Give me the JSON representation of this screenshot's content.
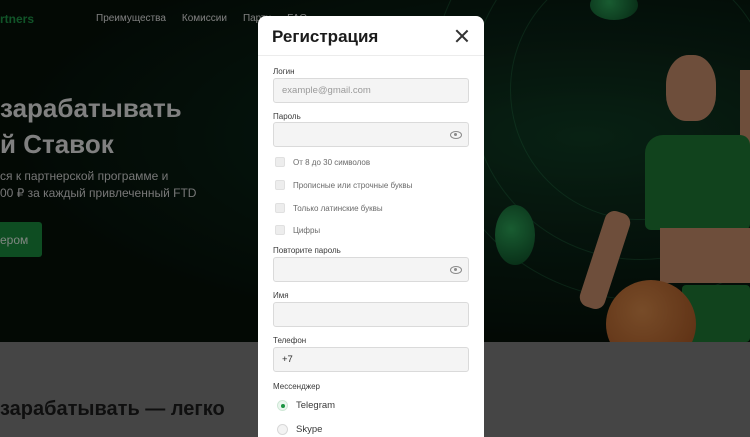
{
  "background": {
    "logo": "rtners",
    "nav": [
      "Преимущества",
      "Комиссии",
      "Партн",
      "FAQ"
    ],
    "hero_title_line1": "зарабатывать",
    "hero_title_line2": "й Ставок",
    "hero_text_line1": "ся к партнерской программе и",
    "hero_text_line2": "00 ₽ за каждый привлеченный FTD",
    "hero_button": "ером",
    "section_title": "зарабатывать — легко"
  },
  "modal": {
    "title": "Регистрация",
    "login": {
      "label": "Логин",
      "value": "",
      "placeholder": "example@gmail.com"
    },
    "password": {
      "label": "Пароль",
      "value": ""
    },
    "rules": [
      "От 8 до 30 символов",
      "Прописные или строчные буквы",
      "Только латинские буквы",
      "Цифры"
    ],
    "password_repeat": {
      "label": "Повторите пароль",
      "value": ""
    },
    "name": {
      "label": "Имя",
      "value": ""
    },
    "phone": {
      "label": "Телефон",
      "value": "+7"
    },
    "messenger": {
      "label": "Мессенджер",
      "options": [
        "Telegram",
        "Skype"
      ],
      "selected": "Telegram"
    }
  },
  "colors": {
    "accent": "#1b9442",
    "overlay": "rgba(0,0,0,0.45)"
  }
}
